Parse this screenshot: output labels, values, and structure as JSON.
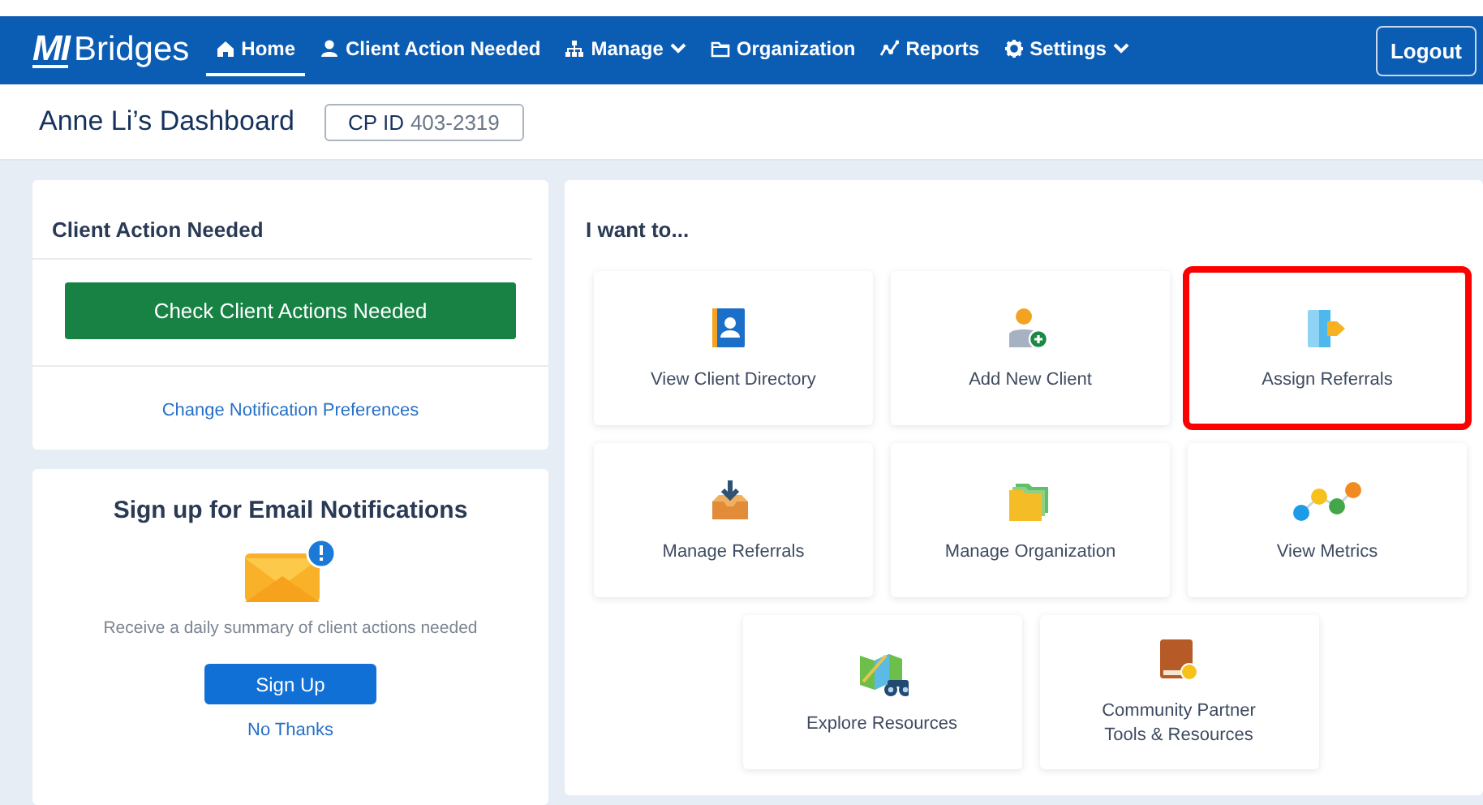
{
  "logo": {
    "mark": "MI",
    "name": "Bridges"
  },
  "nav": [
    {
      "label": "Home",
      "kind": "home",
      "selected": true,
      "has_menu": false
    },
    {
      "label": "Client Action Needed",
      "kind": "person",
      "selected": false,
      "has_menu": false
    },
    {
      "label": "Manage",
      "kind": "hierarchy",
      "selected": false,
      "has_menu": true
    },
    {
      "label": "Organization",
      "kind": "folder",
      "selected": false,
      "has_menu": false
    },
    {
      "label": "Reports",
      "kind": "chart",
      "selected": false,
      "has_menu": false
    },
    {
      "label": "Settings",
      "kind": "gear",
      "selected": false,
      "has_menu": true
    }
  ],
  "logout": "Logout",
  "header": {
    "title": "Anne Li’s Dashboard",
    "id_label": "CP ID",
    "id_value": "403-2319"
  },
  "client_action": {
    "title": "Client Action Needed",
    "button": "Check Client Actions Needed",
    "link": "Change Notification Preferences"
  },
  "email_signup": {
    "title": "Sign up for Email Notifications",
    "text": "Receive a daily summary of client actions needed",
    "button": "Sign Up",
    "link": "No Thanks"
  },
  "actions": {
    "title": "I want to...",
    "tiles": [
      {
        "label": "View Client Directory",
        "kind": "contacts",
        "highlighted": false
      },
      {
        "label": "Add New Client",
        "kind": "addperson",
        "highlighted": false
      },
      {
        "label": "Assign Referrals",
        "kind": "assign",
        "highlighted": true
      },
      {
        "label": "Manage Referrals",
        "kind": "inbox",
        "highlighted": false
      },
      {
        "label": "Manage Organization",
        "kind": "folders",
        "highlighted": false
      },
      {
        "label": "View Metrics",
        "kind": "metrics",
        "highlighted": false
      },
      {
        "label": "Explore Resources",
        "kind": "map",
        "highlighted": false
      },
      {
        "label": "Community Partner Tools & Resources",
        "kind": "book",
        "highlighted": false
      }
    ]
  }
}
